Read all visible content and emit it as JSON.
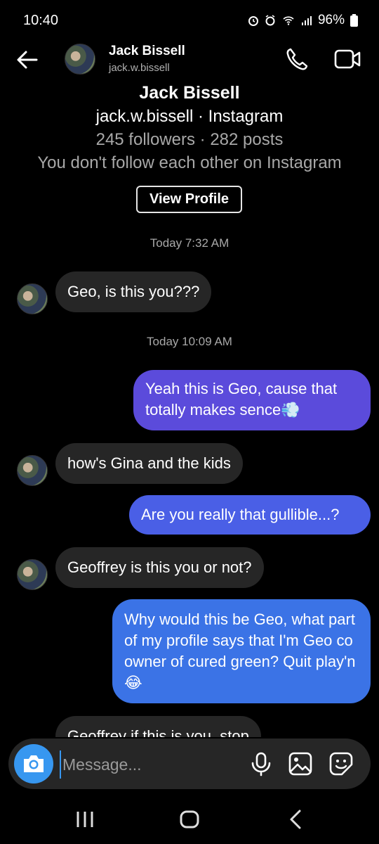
{
  "status_bar": {
    "time": "10:40",
    "battery": "96%"
  },
  "header": {
    "name": "Jack Bissell",
    "username": "jack.w.bissell"
  },
  "profile_card": {
    "name": "Jack Bissell",
    "subtitle": "jack.w.bissell · Instagram",
    "stats": "245 followers · 282 posts",
    "relation": "You don't follow each other on Instagram",
    "view_profile_label": "View Profile"
  },
  "timestamps": [
    "Today 7:32 AM",
    "Today 10:09 AM"
  ],
  "messages": [
    {
      "direction": "in",
      "text": "Geo, is this you???"
    },
    {
      "direction": "out",
      "text": "Yeah this is Geo, cause that totally makes sence💨"
    },
    {
      "direction": "in",
      "text": "how's Gina and the kids"
    },
    {
      "direction": "out",
      "text": "Are you really that gullible...?"
    },
    {
      "direction": "in",
      "text": "Geoffrey is this you or not?"
    },
    {
      "direction": "out",
      "text": "Why would this be Geo, what part of my profile says that I'm Geo co owner of cured green? Quit play'n😂"
    },
    {
      "direction": "in",
      "text": "Geoffrey if this is you, stop"
    }
  ],
  "composer": {
    "placeholder": "Message..."
  },
  "colors": {
    "bubble_in": "#262626",
    "bubble_out_1": "#5b4bdb",
    "bubble_out_2": "#4a5fe6",
    "bubble_out_3": "#3b73e6",
    "accent": "#3797f0"
  },
  "icons": [
    "back-arrow-icon",
    "phone-icon",
    "video-camera-icon",
    "camera-icon",
    "microphone-icon",
    "gallery-icon",
    "sticker-icon",
    "recents-icon",
    "home-icon",
    "nav-back-icon"
  ]
}
